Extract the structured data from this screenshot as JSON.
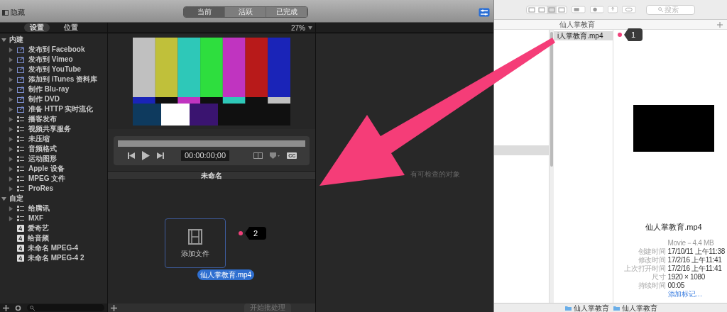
{
  "app": {
    "hide_label": "隐藏",
    "tabs": [
      {
        "label": "当前",
        "selected": true
      },
      {
        "label": "活跃",
        "selected": false
      },
      {
        "label": "已完成",
        "selected": false
      }
    ],
    "sidebar": {
      "tabs": [
        {
          "label": "设置",
          "selected": true
        },
        {
          "label": "位置",
          "selected": false
        }
      ],
      "groups": [
        {
          "label": "内建",
          "expanded": true,
          "children": [
            {
              "label": "发布到 Facebook",
              "kind": "share"
            },
            {
              "label": "发布到 Vimeo",
              "kind": "share"
            },
            {
              "label": "发布到 YouTube",
              "kind": "share"
            },
            {
              "label": "添加到 iTunes 资料库",
              "kind": "share"
            },
            {
              "label": "制作 Blu-ray",
              "kind": "share"
            },
            {
              "label": "制作 DVD",
              "kind": "share"
            },
            {
              "label": "准备 HTTP 实时流化",
              "kind": "share"
            },
            {
              "label": "播客发布",
              "kind": "group"
            },
            {
              "label": "视频共享服务",
              "kind": "group"
            },
            {
              "label": "未压缩",
              "kind": "group"
            },
            {
              "label": "音频格式",
              "kind": "group"
            },
            {
              "label": "运动图形",
              "kind": "group"
            },
            {
              "label": "Apple 设备",
              "kind": "group"
            },
            {
              "label": "MPEG 文件",
              "kind": "group"
            },
            {
              "label": "ProRes",
              "kind": "group"
            }
          ]
        },
        {
          "label": "自定",
          "expanded": true,
          "children": [
            {
              "label": "给腾讯",
              "kind": "group"
            },
            {
              "label": "MXF",
              "kind": "group"
            },
            {
              "label": "爱奇艺",
              "kind": "preset"
            },
            {
              "label": "给音频",
              "kind": "preset"
            },
            {
              "label": "未命名 MPEG-4",
              "kind": "preset"
            },
            {
              "label": "未命名 MPEG-4 2",
              "kind": "preset"
            }
          ]
        }
      ]
    },
    "zoom": "27%",
    "player": {
      "timecode": "00:00:00;00",
      "cc": "CC"
    },
    "batch": {
      "title": "未命名",
      "drop_label": "添加文件",
      "drag_file": "仙人掌教育.mp4",
      "start_button": "开始批处理"
    },
    "inspector": {
      "empty_text": "有可检查的对象"
    }
  },
  "finder": {
    "search": {
      "placeholder": "搜索"
    },
    "column_header": "仙人掌教育",
    "file_row": {
      "label": "i人掌教育.mp4",
      "selected": true
    },
    "preview": {
      "name": "仙人掌教育.mp4",
      "kind_size": "Movie－4.4 MB",
      "info": [
        {
          "label": "创建时间",
          "value": "17/10/11 上午11:38"
        },
        {
          "label": "修改时间",
          "value": "17/2/16 上午11:41"
        },
        {
          "label": "上次打开时间",
          "value": "17/2/16 上午11:41"
        },
        {
          "label": "尺寸",
          "value": "1920 × 1080"
        },
        {
          "label": "持续时间",
          "value": "00:05"
        }
      ],
      "add_tags": "添加标记…"
    },
    "path": [
      "仙人掌教育",
      "仙人掌教育"
    ]
  },
  "callouts": [
    "1",
    "2"
  ]
}
